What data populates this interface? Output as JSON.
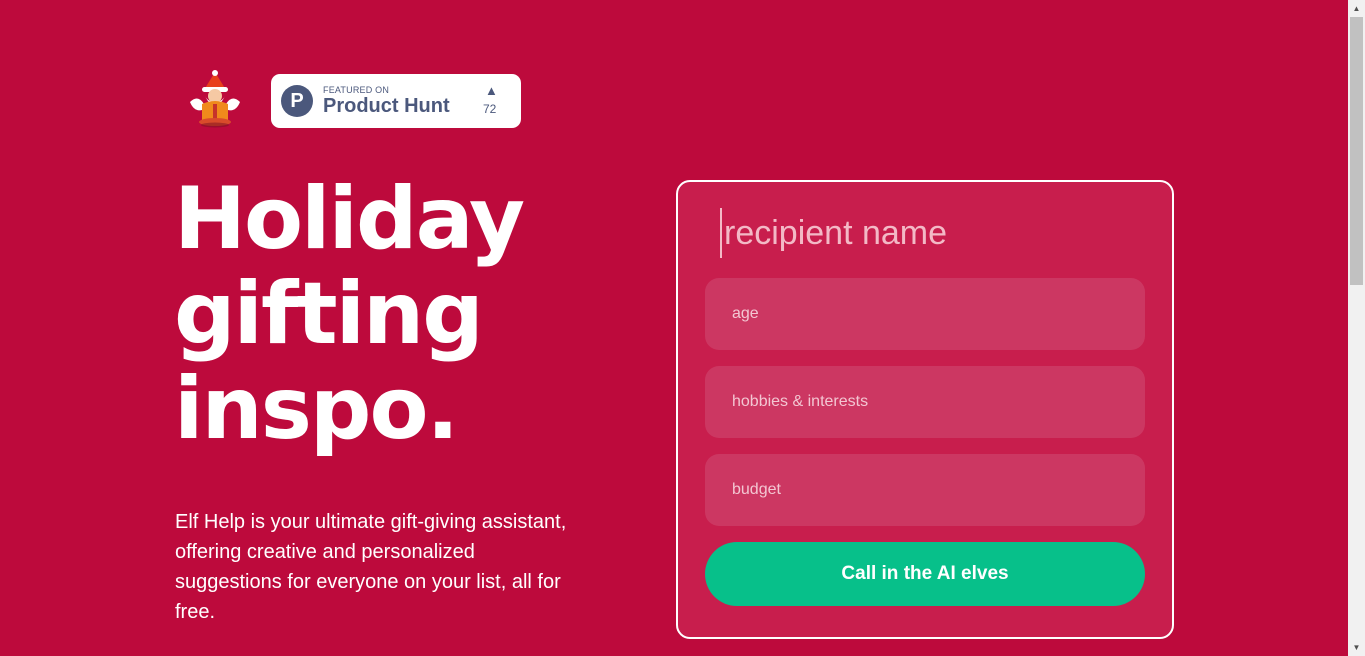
{
  "header": {
    "logo_icon": "santa-elf-logo-icon",
    "product_hunt": {
      "icon": "product-hunt-p-icon",
      "icon_letter": "P",
      "featured_label": "FEATURED ON",
      "name": "Product Hunt",
      "upvote_icon": "upvote-triangle-icon",
      "upvote_symbol": "▲",
      "count": "72"
    }
  },
  "hero": {
    "headline_lines": [
      "Holiday",
      "gifting",
      "inspo."
    ],
    "description": "Elf Help is your ultimate gift-giving assistant, offering creative and personalized suggestions for everyone on your list, all for free."
  },
  "form": {
    "recipient_placeholder": "recipient name",
    "age_placeholder": "age",
    "hobbies_placeholder": "hobbies & interests",
    "budget_placeholder": "budget",
    "submit_label": "Call in the AI elves"
  },
  "colors": {
    "background": "#bd0a3c",
    "card": "#c81e4d",
    "field": "#cc3762",
    "button": "#07c08a",
    "product_hunt_text": "#4b587c"
  }
}
